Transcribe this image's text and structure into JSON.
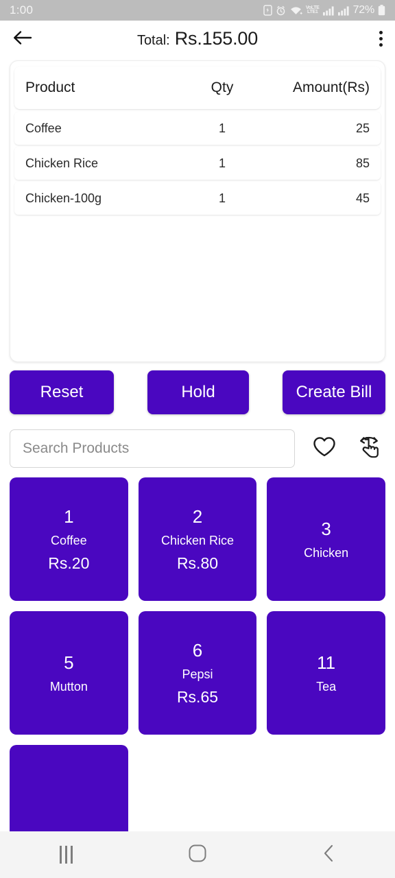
{
  "status_bar": {
    "time": "1:00",
    "battery_percent": "72%",
    "network_label_top": "VoLTE",
    "network_label_bottom": "LTE1",
    "icons": [
      "sim-card-icon",
      "alarm-icon",
      "wifi-icon",
      "volte-icon",
      "signal-bars-icon",
      "signal-bars-icon",
      "battery-icon"
    ]
  },
  "app_bar": {
    "back_icon": "arrow-left-icon",
    "title_prefix": "Total:",
    "title_amount": "Rs.155.00",
    "overflow_icon": "more-vertical-icon"
  },
  "receipt": {
    "columns": [
      "Product",
      "Qty",
      "Amount(Rs)"
    ],
    "rows": [
      {
        "product": "Coffee",
        "qty": "1",
        "amount": "25"
      },
      {
        "product": "Chicken Rice",
        "qty": "1",
        "amount": "85"
      },
      {
        "product": "Chicken-100g",
        "qty": "1",
        "amount": "45"
      }
    ]
  },
  "actions": {
    "reset_label": "Reset",
    "hold_label": "Hold",
    "create_bill_label": "Create Bill"
  },
  "search": {
    "placeholder": "Search Products",
    "value": "",
    "favorite_icon": "heart-icon",
    "gesture_icon": "swipe-gesture-icon"
  },
  "products": [
    {
      "id": "1",
      "name": "Coffee",
      "price": "Rs.20"
    },
    {
      "id": "2",
      "name": "Chicken Rice",
      "price": "Rs.80"
    },
    {
      "id": "3",
      "name": "Chicken",
      "price": ""
    },
    {
      "id": "5",
      "name": "Mutton",
      "price": ""
    },
    {
      "id": "6",
      "name": "Pepsi",
      "price": "Rs.65"
    },
    {
      "id": "11",
      "name": "Tea",
      "price": ""
    }
  ],
  "add_product": {
    "label": "+"
  },
  "nav_bar": {
    "recents_icon": "recents-icon",
    "home_icon": "home-icon",
    "back_icon": "back-chevron-icon"
  },
  "colors": {
    "primary_purple": "#4a07c0",
    "status_bar_gray": "#bcbcbc",
    "nav_bar_gray": "#f4f4f4"
  }
}
